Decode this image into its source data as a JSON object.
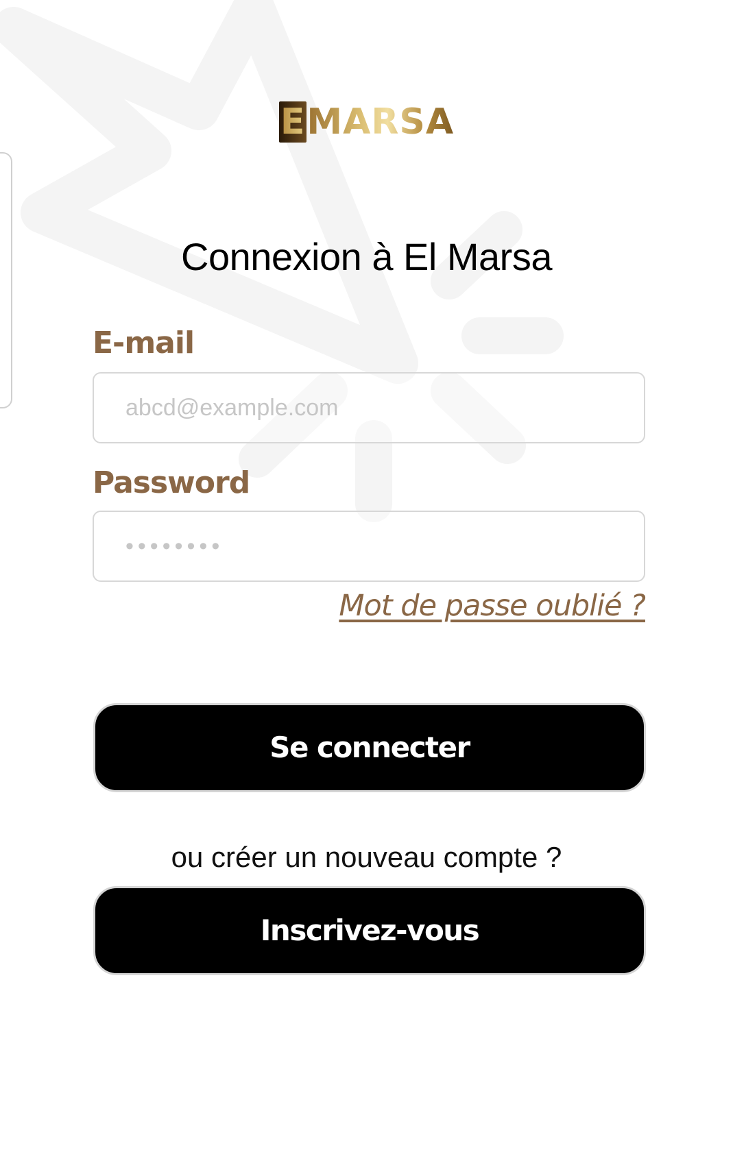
{
  "logo": {
    "first_letter": "E",
    "rest": "MARSA"
  },
  "title": "Connexion à El Marsa",
  "email": {
    "label": "E-mail",
    "placeholder": "abcd@example.com"
  },
  "password": {
    "label": "Password",
    "placeholder": "••••••••"
  },
  "forgot_password": "Mot de passe oublié ?",
  "login_button": "Se connecter",
  "alt_prompt": "ou créer un nouveau compte ?",
  "signup_button": "Inscrivez-vous",
  "colors": {
    "label_brown": "#8a6746",
    "button_black": "#000000",
    "logo_gold": "#d8bb6e"
  }
}
